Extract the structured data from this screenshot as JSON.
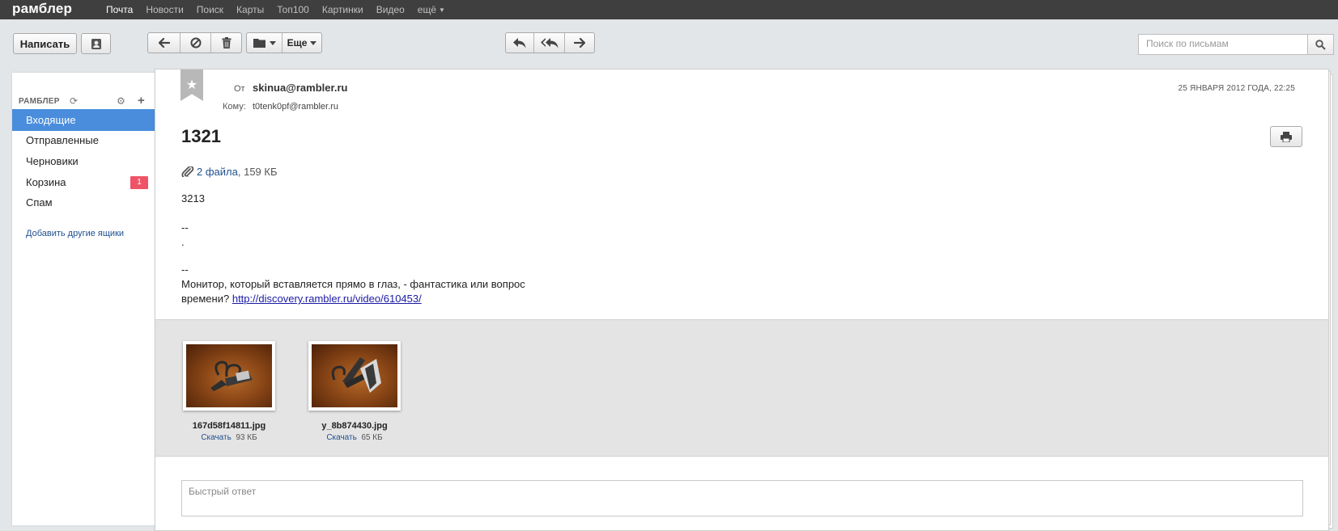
{
  "topbar": {
    "logo": "рамблер",
    "nav": [
      "Почта",
      "Новости",
      "Поиск",
      "Карты",
      "Топ100",
      "Картинки",
      "Видео",
      "ещё"
    ]
  },
  "toolbar": {
    "compose_label": "Написать",
    "more_label": "Еще",
    "search_placeholder": "Поиск по письмам"
  },
  "sidebar": {
    "account": "РАМБЛЕР",
    "folders": [
      {
        "label": "Входящие",
        "active": true
      },
      {
        "label": "Отправленные"
      },
      {
        "label": "Черновики"
      },
      {
        "label": "Корзина",
        "badge": "1"
      },
      {
        "label": "Спам"
      }
    ],
    "add_link": "Добавить другие ящики"
  },
  "message": {
    "from_label": "От",
    "from": "skinua@rambler.ru",
    "to_label": "Кому:",
    "to": "t0tenk0pf@rambler.ru",
    "date": "25 ЯНВАРЯ 2012 ГОДА, 22:25",
    "subject": "1321",
    "attachments_link": "2 файла",
    "attachments_size": ", 159 КБ",
    "body": {
      "line1": "3213",
      "sig1_dash": "--",
      "sig1_dot": ".",
      "sig2_dash": "--",
      "ad_text_1": "Монитор, который вставляется прямо в глаз, - фантастика или вопрос",
      "ad_text_2": "времени?",
      "ad_link": "http://discovery.rambler.ru/video/610453/"
    },
    "files": [
      {
        "name": "167d58f14811.jpg",
        "download": "Скачать",
        "size": "93 КБ"
      },
      {
        "name": "y_8b874430.jpg",
        "download": "Скачать",
        "size": "65 КБ"
      }
    ],
    "quick_reply_placeholder": "Быстрый ответ"
  },
  "colors": {
    "accent": "#4a8ddc",
    "badge": "#ef5466",
    "topbar": "#3f3f3f"
  }
}
